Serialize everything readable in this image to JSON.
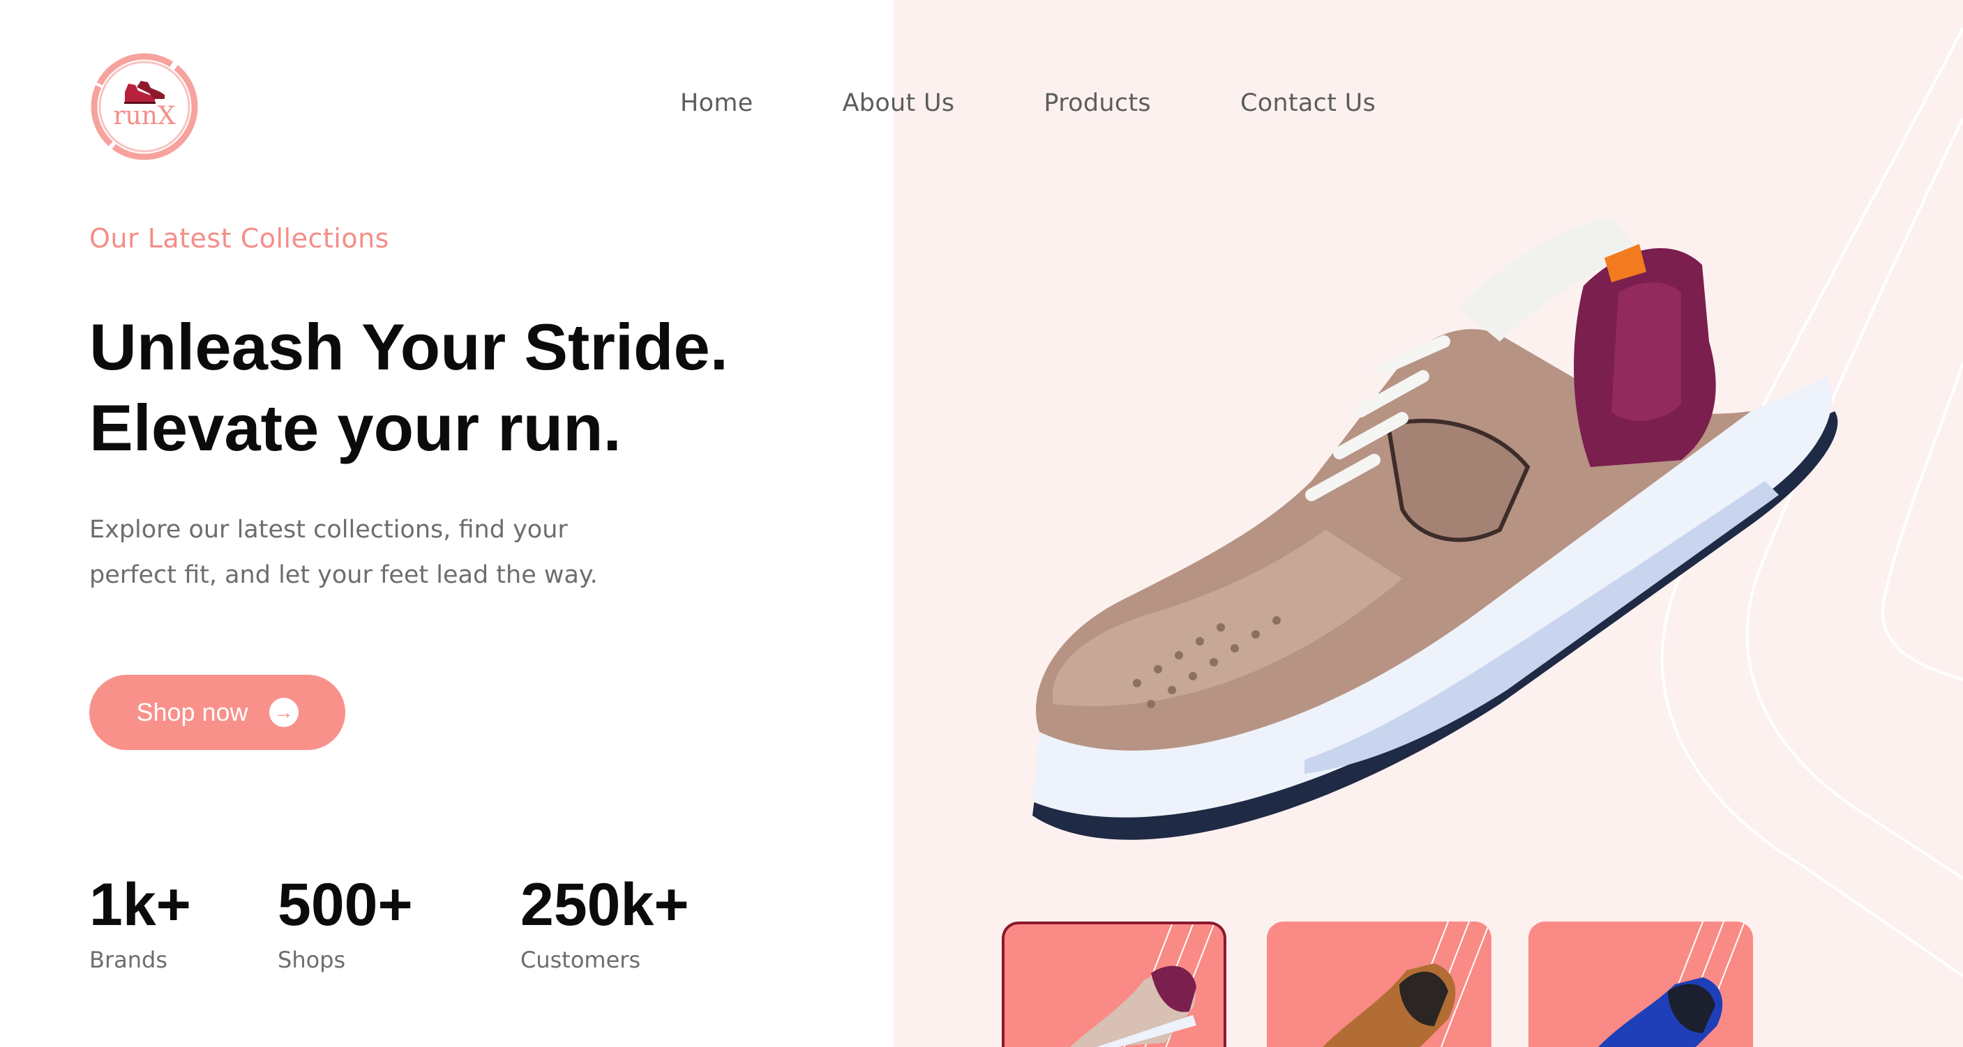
{
  "brand": {
    "name": "runX",
    "logo_icon": "shoe-logo-icon"
  },
  "nav": {
    "items": [
      "Home",
      "About Us",
      "Products",
      "Contact Us"
    ]
  },
  "hero": {
    "eyebrow": "Our Latest Collections",
    "headline_line1": "Unleash Your Stride.",
    "headline_line2": "Elevate your run.",
    "subtext_line1": "Explore our latest collections, find your",
    "subtext_line2": "perfect fit, and let your feet lead the way.",
    "cta_label": "Shop now",
    "cta_icon": "arrow-right-icon"
  },
  "stats": [
    {
      "value": "1k+",
      "label": "Brands"
    },
    {
      "value": "500+",
      "label": "Shops"
    },
    {
      "value": "250k+",
      "label": "Customers"
    }
  ],
  "thumbnails": [
    {
      "shoe": "beige-maroon-sneaker",
      "selected": true
    },
    {
      "shoe": "brown-black-sneaker",
      "selected": false
    },
    {
      "shoe": "blue-black-sneaker",
      "selected": false
    }
  ],
  "colors": {
    "accent": "#f9918b",
    "panel_bg": "#fdf1f0",
    "heading": "#0b0b0b",
    "body_text": "#6d6d6d",
    "active_border": "#8c1a2c"
  }
}
